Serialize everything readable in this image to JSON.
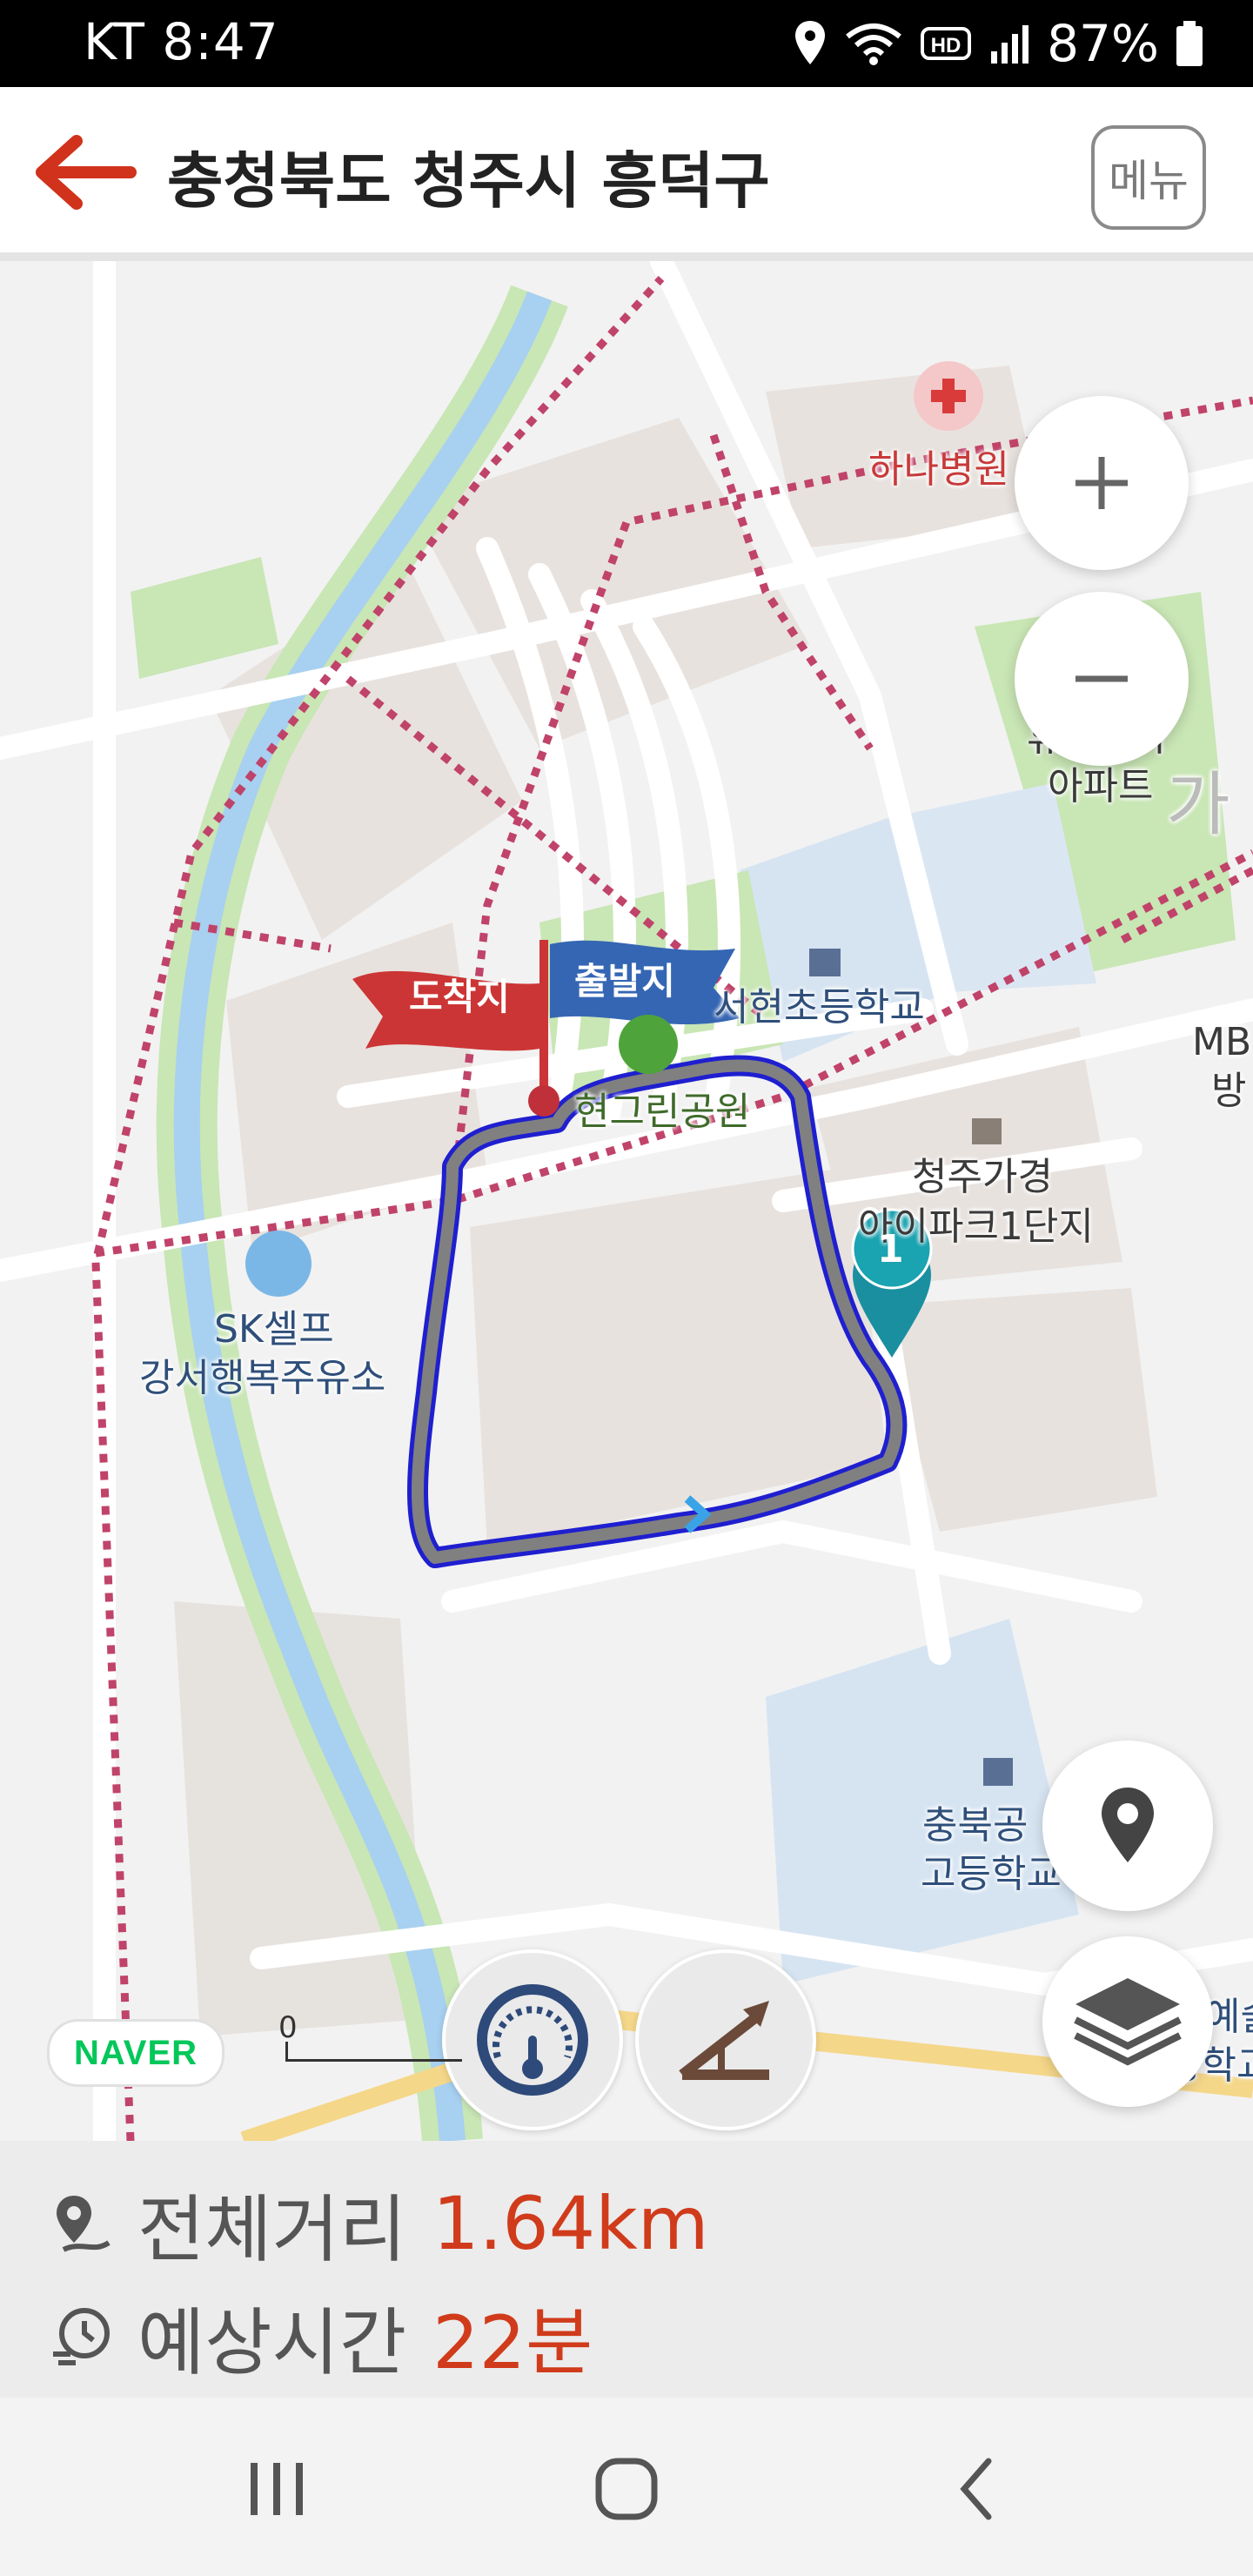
{
  "status_bar": {
    "carrier_time": "KT 8:47",
    "battery": "87%",
    "icons": [
      "location-icon",
      "wifi-icon",
      "hd-icon",
      "signal-icon",
      "battery-icon"
    ]
  },
  "header": {
    "title": "충청북도 청주시 흥덕구",
    "menu_label": "메뉴",
    "back_icon": "arrow-left-icon"
  },
  "map": {
    "labels": {
      "hospital": "하나병원",
      "apt1_line1": "휴먼시아",
      "apt1_line2": "아파트",
      "school1": "서현초등학교",
      "park": "현그린공원",
      "apt2_line1": "청주가경",
      "apt2_line2": "아이파크1단지",
      "gas_line1": "SK셀프",
      "gas_line2": "강서행복주유소",
      "school2_line1": "충북공",
      "school2_line2": "고등학교",
      "mb_line1": "MB",
      "mb_line2": "방",
      "right_char": "가",
      "right_bottom_line1": "예술",
      "right_bottom_line2": "중학교"
    },
    "flags": {
      "arrival": "도착지",
      "departure": "출발지"
    },
    "waypoint": "1",
    "scale_label": "0",
    "naver_logo": "NAVER",
    "colors": {
      "route_outer": "#1f1fd0",
      "route_inner": "#808080",
      "trail": "#c0436a",
      "water": "#a8d0f0",
      "park": "#c9e6b5"
    }
  },
  "summary": {
    "distance_label": "전체거리",
    "distance_value": "1.64km",
    "time_label": "예상시간",
    "time_value": "22분"
  }
}
